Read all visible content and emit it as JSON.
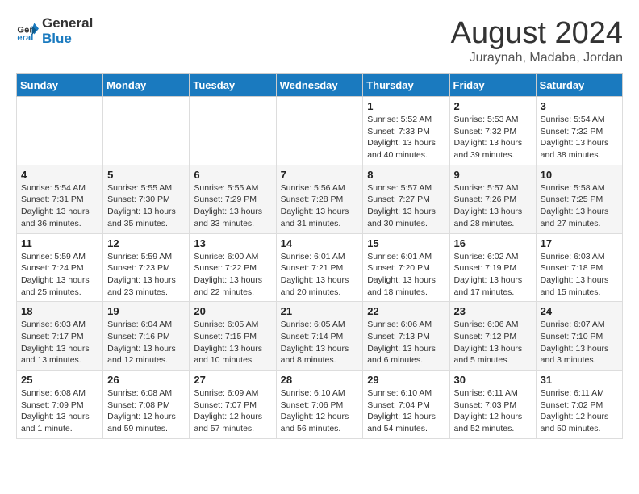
{
  "header": {
    "logo_line1": "General",
    "logo_line2": "Blue",
    "month": "August 2024",
    "location": "Juraynah, Madaba, Jordan"
  },
  "weekdays": [
    "Sunday",
    "Monday",
    "Tuesday",
    "Wednesday",
    "Thursday",
    "Friday",
    "Saturday"
  ],
  "weeks": [
    [
      {
        "day": "",
        "info": ""
      },
      {
        "day": "",
        "info": ""
      },
      {
        "day": "",
        "info": ""
      },
      {
        "day": "",
        "info": ""
      },
      {
        "day": "1",
        "info": "Sunrise: 5:52 AM\nSunset: 7:33 PM\nDaylight: 13 hours\nand 40 minutes."
      },
      {
        "day": "2",
        "info": "Sunrise: 5:53 AM\nSunset: 7:32 PM\nDaylight: 13 hours\nand 39 minutes."
      },
      {
        "day": "3",
        "info": "Sunrise: 5:54 AM\nSunset: 7:32 PM\nDaylight: 13 hours\nand 38 minutes."
      }
    ],
    [
      {
        "day": "4",
        "info": "Sunrise: 5:54 AM\nSunset: 7:31 PM\nDaylight: 13 hours\nand 36 minutes."
      },
      {
        "day": "5",
        "info": "Sunrise: 5:55 AM\nSunset: 7:30 PM\nDaylight: 13 hours\nand 35 minutes."
      },
      {
        "day": "6",
        "info": "Sunrise: 5:55 AM\nSunset: 7:29 PM\nDaylight: 13 hours\nand 33 minutes."
      },
      {
        "day": "7",
        "info": "Sunrise: 5:56 AM\nSunset: 7:28 PM\nDaylight: 13 hours\nand 31 minutes."
      },
      {
        "day": "8",
        "info": "Sunrise: 5:57 AM\nSunset: 7:27 PM\nDaylight: 13 hours\nand 30 minutes."
      },
      {
        "day": "9",
        "info": "Sunrise: 5:57 AM\nSunset: 7:26 PM\nDaylight: 13 hours\nand 28 minutes."
      },
      {
        "day": "10",
        "info": "Sunrise: 5:58 AM\nSunset: 7:25 PM\nDaylight: 13 hours\nand 27 minutes."
      }
    ],
    [
      {
        "day": "11",
        "info": "Sunrise: 5:59 AM\nSunset: 7:24 PM\nDaylight: 13 hours\nand 25 minutes."
      },
      {
        "day": "12",
        "info": "Sunrise: 5:59 AM\nSunset: 7:23 PM\nDaylight: 13 hours\nand 23 minutes."
      },
      {
        "day": "13",
        "info": "Sunrise: 6:00 AM\nSunset: 7:22 PM\nDaylight: 13 hours\nand 22 minutes."
      },
      {
        "day": "14",
        "info": "Sunrise: 6:01 AM\nSunset: 7:21 PM\nDaylight: 13 hours\nand 20 minutes."
      },
      {
        "day": "15",
        "info": "Sunrise: 6:01 AM\nSunset: 7:20 PM\nDaylight: 13 hours\nand 18 minutes."
      },
      {
        "day": "16",
        "info": "Sunrise: 6:02 AM\nSunset: 7:19 PM\nDaylight: 13 hours\nand 17 minutes."
      },
      {
        "day": "17",
        "info": "Sunrise: 6:03 AM\nSunset: 7:18 PM\nDaylight: 13 hours\nand 15 minutes."
      }
    ],
    [
      {
        "day": "18",
        "info": "Sunrise: 6:03 AM\nSunset: 7:17 PM\nDaylight: 13 hours\nand 13 minutes."
      },
      {
        "day": "19",
        "info": "Sunrise: 6:04 AM\nSunset: 7:16 PM\nDaylight: 13 hours\nand 12 minutes."
      },
      {
        "day": "20",
        "info": "Sunrise: 6:05 AM\nSunset: 7:15 PM\nDaylight: 13 hours\nand 10 minutes."
      },
      {
        "day": "21",
        "info": "Sunrise: 6:05 AM\nSunset: 7:14 PM\nDaylight: 13 hours\nand 8 minutes."
      },
      {
        "day": "22",
        "info": "Sunrise: 6:06 AM\nSunset: 7:13 PM\nDaylight: 13 hours\nand 6 minutes."
      },
      {
        "day": "23",
        "info": "Sunrise: 6:06 AM\nSunset: 7:12 PM\nDaylight: 13 hours\nand 5 minutes."
      },
      {
        "day": "24",
        "info": "Sunrise: 6:07 AM\nSunset: 7:10 PM\nDaylight: 13 hours\nand 3 minutes."
      }
    ],
    [
      {
        "day": "25",
        "info": "Sunrise: 6:08 AM\nSunset: 7:09 PM\nDaylight: 13 hours\nand 1 minute."
      },
      {
        "day": "26",
        "info": "Sunrise: 6:08 AM\nSunset: 7:08 PM\nDaylight: 12 hours\nand 59 minutes."
      },
      {
        "day": "27",
        "info": "Sunrise: 6:09 AM\nSunset: 7:07 PM\nDaylight: 12 hours\nand 57 minutes."
      },
      {
        "day": "28",
        "info": "Sunrise: 6:10 AM\nSunset: 7:06 PM\nDaylight: 12 hours\nand 56 minutes."
      },
      {
        "day": "29",
        "info": "Sunrise: 6:10 AM\nSunset: 7:04 PM\nDaylight: 12 hours\nand 54 minutes."
      },
      {
        "day": "30",
        "info": "Sunrise: 6:11 AM\nSunset: 7:03 PM\nDaylight: 12 hours\nand 52 minutes."
      },
      {
        "day": "31",
        "info": "Sunrise: 6:11 AM\nSunset: 7:02 PM\nDaylight: 12 hours\nand 50 minutes."
      }
    ]
  ]
}
